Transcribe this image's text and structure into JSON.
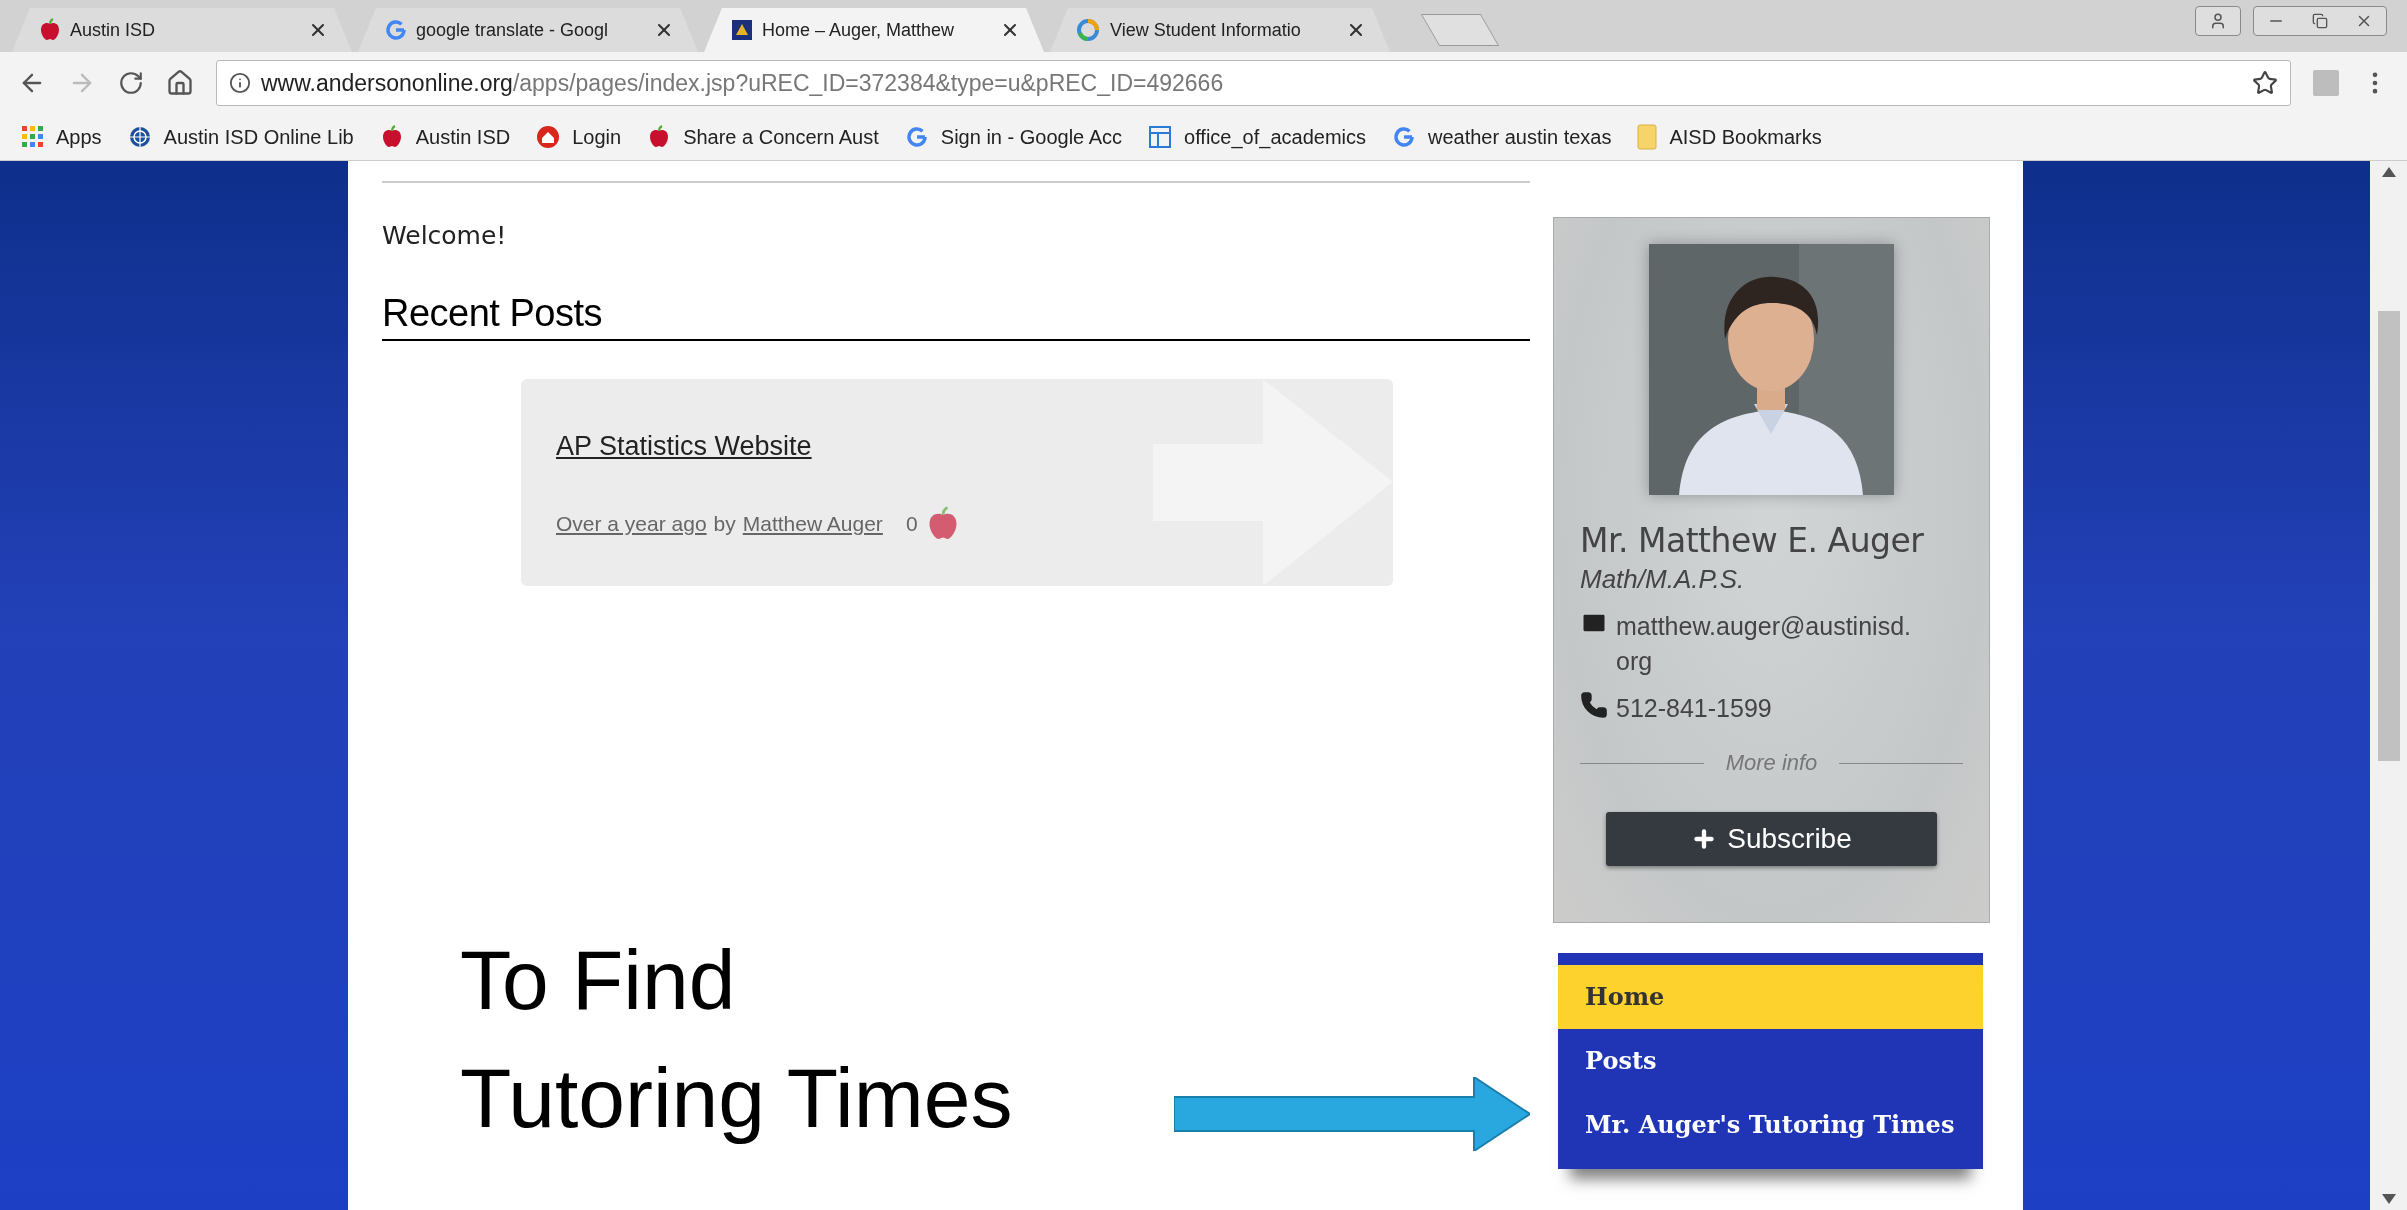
{
  "browser": {
    "tabs": [
      {
        "title": "Austin ISD",
        "selected": false
      },
      {
        "title": "google translate - Googl",
        "selected": false
      },
      {
        "title": "Home – Auger, Matthew",
        "selected": true
      },
      {
        "title": "View Student Informatio",
        "selected": false
      }
    ],
    "url": {
      "host": "www.andersononline.org",
      "path": "/apps/pages/index.jsp?uREC_ID=372384&type=u&pREC_ID=492666"
    },
    "bookmarks": [
      {
        "label": "Apps"
      },
      {
        "label": "Austin ISD Online Lib"
      },
      {
        "label": "Austin ISD"
      },
      {
        "label": "Login"
      },
      {
        "label": "Share a Concern Aust"
      },
      {
        "label": "Sign in - Google Acc"
      },
      {
        "label": "office_of_academics"
      },
      {
        "label": "weather austin texas"
      },
      {
        "label": "AISD Bookmarks"
      }
    ]
  },
  "page": {
    "welcome": "Welcome!",
    "recent_posts": {
      "heading": "Recent Posts",
      "posts": [
        {
          "title": "AP Statistics Website",
          "time": "Over a year ago",
          "by": "by",
          "author": "Matthew Auger",
          "likes": "0"
        }
      ]
    },
    "profile": {
      "kind": "picture",
      "name": "Mr. Matthew E. Auger",
      "subject": "Math/M.A.P.S.",
      "email": "matthew.auger@austinisd.org",
      "phone": "512-841-1599",
      "more_info": "More info",
      "subscribe": "Subscribe"
    },
    "nav": [
      {
        "label": "Home",
        "selected": true
      },
      {
        "label": "Posts",
        "selected": false
      },
      {
        "label": "Mr. Auger's Tutoring Times",
        "selected": false
      }
    ]
  },
  "annotation": {
    "lines": [
      "To Find",
      "Tutoring Times"
    ]
  }
}
